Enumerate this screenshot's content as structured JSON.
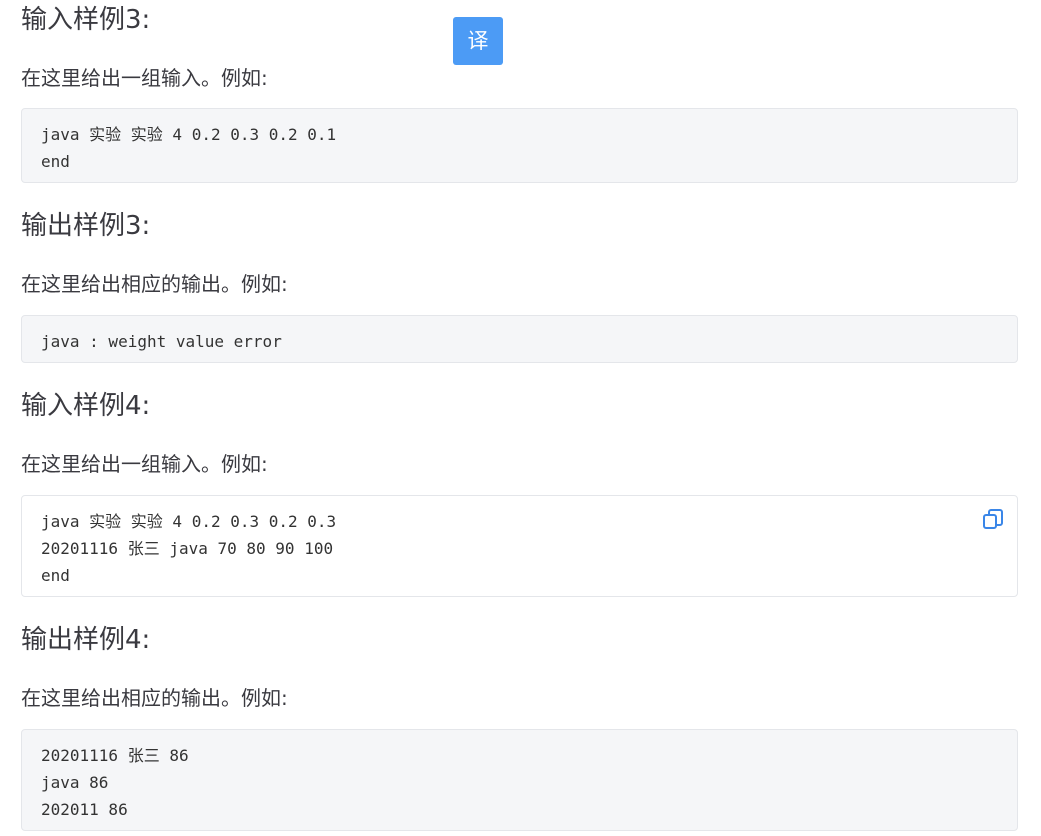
{
  "translate_button": {
    "label": "译"
  },
  "sections": [
    {
      "heading": "输入样例3:",
      "description": "在这里给出一组输入。例如:",
      "code": [
        "java 实验 实验 4 0.2 0.3 0.2 0.1",
        "end"
      ]
    },
    {
      "heading": "输出样例3:",
      "description": "在这里给出相应的输出。例如:",
      "code": [
        "java : weight value error"
      ]
    },
    {
      "heading": "输入样例4:",
      "description": "在这里给出一组输入。例如:",
      "code": [
        "java 实验 实验 4 0.2 0.3 0.2 0.3",
        "20201116 张三 java 70 80 90 100",
        "end"
      ]
    },
    {
      "heading": "输出样例4:",
      "description": "在这里给出相应的输出。例如:",
      "code": [
        "20201116 张三 86",
        "java 86",
        "202011 86"
      ]
    }
  ],
  "icons": {
    "copy": "copy-icon",
    "copy_color": "#3a86e8"
  },
  "colors": {
    "translate_button_bg": "#4c9bf5",
    "code_bg": "#f5f6f8",
    "code_border": "#e4e6ea"
  }
}
